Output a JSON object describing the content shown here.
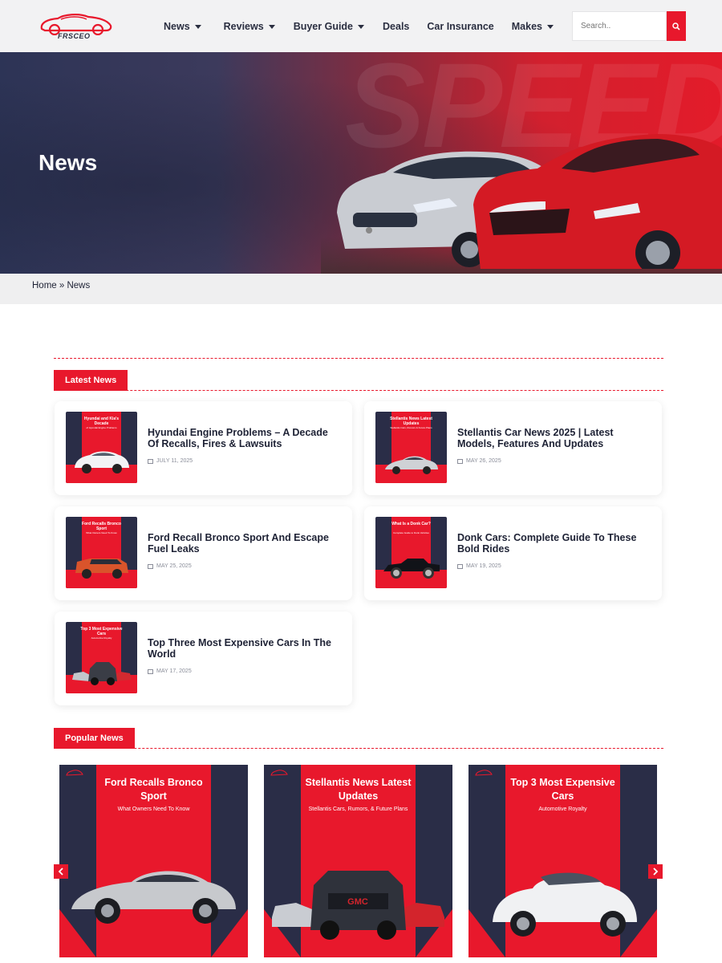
{
  "brand": {
    "logo_text": "FRSCEO",
    "accent": "#e8182c",
    "dark": "#2a2d47"
  },
  "nav": [
    {
      "label": "News",
      "has_dropdown": true
    },
    {
      "label": "Reviews",
      "has_dropdown": true
    },
    {
      "label": "Buyer Guide",
      "has_dropdown": true
    },
    {
      "label": "Deals",
      "has_dropdown": false
    },
    {
      "label": "Car Insurance",
      "has_dropdown": false
    },
    {
      "label": "Makes",
      "has_dropdown": true
    }
  ],
  "search": {
    "placeholder": "Search..",
    "icon": "search-icon"
  },
  "hero": {
    "title": "News",
    "bg_word": "SPEED"
  },
  "breadcrumb": {
    "home": "Home",
    "sep": " » ",
    "current": "News"
  },
  "latest": {
    "heading": "Latest News",
    "items": [
      {
        "title": "Hyundai Engine Problems – A Decade Of Recalls, Fires & Lawsuits",
        "date": "JULY 11, 2025",
        "thumb_title": "Hyundai and Kia's Decade",
        "thumb_sub": "of Hyundai Engine Problems",
        "thumb_car": "white-suv"
      },
      {
        "title": "Stellantis Car News 2025 | Latest Models, Features And Updates",
        "date": "MAY 26, 2025",
        "thumb_title": "Stellantis News Latest Updates",
        "thumb_sub": "Stellantis Cars, Rumors & Future Plans",
        "thumb_car": "silver-coupe"
      },
      {
        "title": "Ford Recall Bronco Sport And Escape Fuel Leaks",
        "date": "MAY 25, 2025",
        "thumb_title": "Ford Recalls Bronco Sport",
        "thumb_sub": "What Owners Need To Know",
        "thumb_car": "orange-suv"
      },
      {
        "title": "Donk Cars: Complete Guide To These Bold Rides",
        "date": "MAY 19, 2025",
        "thumb_title": "What Is a Donk Car?",
        "thumb_sub": "Complete Guide to Donk Vehicles",
        "thumb_car": "black-donk"
      },
      {
        "title": "Top Three Most Expensive Cars In The World",
        "date": "MAY 17, 2025",
        "thumb_title": "Top 3 Most Expensive Cars",
        "thumb_sub": "Automotive Royalty",
        "thumb_car": "three-cars"
      }
    ]
  },
  "popular": {
    "heading": "Popular News",
    "items": [
      {
        "title": "Ford Recalls Bronco Sport",
        "sub": "What Owners Need To Know",
        "car": "silver-coupe"
      },
      {
        "title": "Stellantis News Latest Updates",
        "sub": "Stellantis Cars, Rumors, & Future Plans",
        "car": "gmc-group"
      },
      {
        "title": "Top 3 Most Expensive Cars",
        "sub": "Automotive Royalty",
        "car": "white-suv"
      }
    ]
  }
}
